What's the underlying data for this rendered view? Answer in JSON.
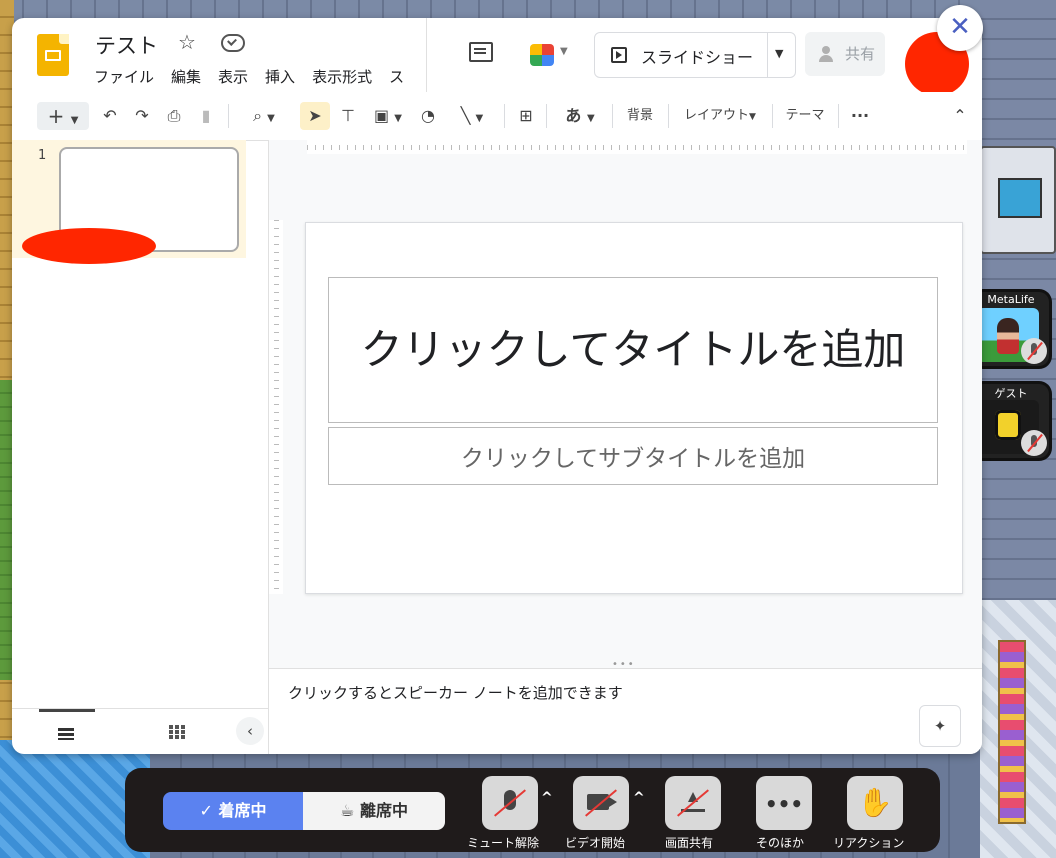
{
  "slides": {
    "doc_title": "テスト",
    "menu": [
      "ファイル",
      "編集",
      "表示",
      "挿入",
      "表示形式",
      "ス"
    ],
    "present_label": "スライドショー",
    "share_label": "共有",
    "toolbar": {
      "background_label": "背景",
      "layout_label": "レイアウト",
      "theme_label": "テーマ",
      "font_label": "あ",
      "more_label": "···"
    },
    "slide_number": "1",
    "slide": {
      "title_placeholder": "クリックしてタイトルを追加",
      "subtitle_placeholder": "クリックしてサブタイトルを追加"
    },
    "notes_placeholder": "クリックするとスピーカー ノートを追加できます",
    "colors": {
      "accent": "#f4b400",
      "selection": "#fef6e0"
    }
  },
  "participants": [
    {
      "name": "MetaLife",
      "mic": "muted"
    },
    {
      "name": "ゲスト",
      "mic": "muted"
    }
  ],
  "controls": {
    "status_present": "着席中",
    "status_away": "離席中",
    "unmute_label": "ミュート解除",
    "video_label": "ビデオ開始",
    "screen_share_label": "画面共有",
    "more_label": "そのほか",
    "reaction_label": "リアクション",
    "colors": {
      "status_active": "#5b82f0",
      "muted_slash": "#e53935"
    }
  }
}
